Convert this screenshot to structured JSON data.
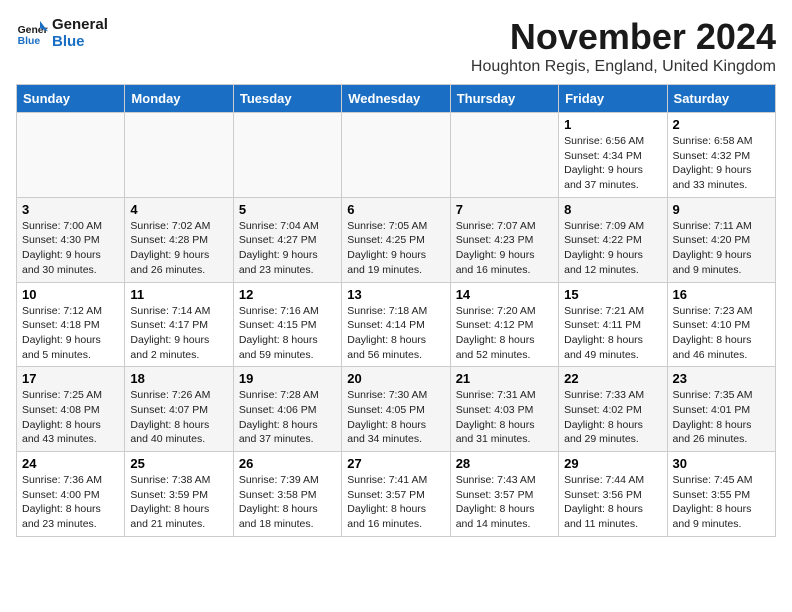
{
  "logo": {
    "line1": "General",
    "line2": "Blue"
  },
  "title": "November 2024",
  "subtitle": "Houghton Regis, England, United Kingdom",
  "days_of_week": [
    "Sunday",
    "Monday",
    "Tuesday",
    "Wednesday",
    "Thursday",
    "Friday",
    "Saturday"
  ],
  "weeks": [
    [
      {
        "day": "",
        "info": ""
      },
      {
        "day": "",
        "info": ""
      },
      {
        "day": "",
        "info": ""
      },
      {
        "day": "",
        "info": ""
      },
      {
        "day": "",
        "info": ""
      },
      {
        "day": "1",
        "info": "Sunrise: 6:56 AM\nSunset: 4:34 PM\nDaylight: 9 hours and 37 minutes."
      },
      {
        "day": "2",
        "info": "Sunrise: 6:58 AM\nSunset: 4:32 PM\nDaylight: 9 hours and 33 minutes."
      }
    ],
    [
      {
        "day": "3",
        "info": "Sunrise: 7:00 AM\nSunset: 4:30 PM\nDaylight: 9 hours and 30 minutes."
      },
      {
        "day": "4",
        "info": "Sunrise: 7:02 AM\nSunset: 4:28 PM\nDaylight: 9 hours and 26 minutes."
      },
      {
        "day": "5",
        "info": "Sunrise: 7:04 AM\nSunset: 4:27 PM\nDaylight: 9 hours and 23 minutes."
      },
      {
        "day": "6",
        "info": "Sunrise: 7:05 AM\nSunset: 4:25 PM\nDaylight: 9 hours and 19 minutes."
      },
      {
        "day": "7",
        "info": "Sunrise: 7:07 AM\nSunset: 4:23 PM\nDaylight: 9 hours and 16 minutes."
      },
      {
        "day": "8",
        "info": "Sunrise: 7:09 AM\nSunset: 4:22 PM\nDaylight: 9 hours and 12 minutes."
      },
      {
        "day": "9",
        "info": "Sunrise: 7:11 AM\nSunset: 4:20 PM\nDaylight: 9 hours and 9 minutes."
      }
    ],
    [
      {
        "day": "10",
        "info": "Sunrise: 7:12 AM\nSunset: 4:18 PM\nDaylight: 9 hours and 5 minutes."
      },
      {
        "day": "11",
        "info": "Sunrise: 7:14 AM\nSunset: 4:17 PM\nDaylight: 9 hours and 2 minutes."
      },
      {
        "day": "12",
        "info": "Sunrise: 7:16 AM\nSunset: 4:15 PM\nDaylight: 8 hours and 59 minutes."
      },
      {
        "day": "13",
        "info": "Sunrise: 7:18 AM\nSunset: 4:14 PM\nDaylight: 8 hours and 56 minutes."
      },
      {
        "day": "14",
        "info": "Sunrise: 7:20 AM\nSunset: 4:12 PM\nDaylight: 8 hours and 52 minutes."
      },
      {
        "day": "15",
        "info": "Sunrise: 7:21 AM\nSunset: 4:11 PM\nDaylight: 8 hours and 49 minutes."
      },
      {
        "day": "16",
        "info": "Sunrise: 7:23 AM\nSunset: 4:10 PM\nDaylight: 8 hours and 46 minutes."
      }
    ],
    [
      {
        "day": "17",
        "info": "Sunrise: 7:25 AM\nSunset: 4:08 PM\nDaylight: 8 hours and 43 minutes."
      },
      {
        "day": "18",
        "info": "Sunrise: 7:26 AM\nSunset: 4:07 PM\nDaylight: 8 hours and 40 minutes."
      },
      {
        "day": "19",
        "info": "Sunrise: 7:28 AM\nSunset: 4:06 PM\nDaylight: 8 hours and 37 minutes."
      },
      {
        "day": "20",
        "info": "Sunrise: 7:30 AM\nSunset: 4:05 PM\nDaylight: 8 hours and 34 minutes."
      },
      {
        "day": "21",
        "info": "Sunrise: 7:31 AM\nSunset: 4:03 PM\nDaylight: 8 hours and 31 minutes."
      },
      {
        "day": "22",
        "info": "Sunrise: 7:33 AM\nSunset: 4:02 PM\nDaylight: 8 hours and 29 minutes."
      },
      {
        "day": "23",
        "info": "Sunrise: 7:35 AM\nSunset: 4:01 PM\nDaylight: 8 hours and 26 minutes."
      }
    ],
    [
      {
        "day": "24",
        "info": "Sunrise: 7:36 AM\nSunset: 4:00 PM\nDaylight: 8 hours and 23 minutes."
      },
      {
        "day": "25",
        "info": "Sunrise: 7:38 AM\nSunset: 3:59 PM\nDaylight: 8 hours and 21 minutes."
      },
      {
        "day": "26",
        "info": "Sunrise: 7:39 AM\nSunset: 3:58 PM\nDaylight: 8 hours and 18 minutes."
      },
      {
        "day": "27",
        "info": "Sunrise: 7:41 AM\nSunset: 3:57 PM\nDaylight: 8 hours and 16 minutes."
      },
      {
        "day": "28",
        "info": "Sunrise: 7:43 AM\nSunset: 3:57 PM\nDaylight: 8 hours and 14 minutes."
      },
      {
        "day": "29",
        "info": "Sunrise: 7:44 AM\nSunset: 3:56 PM\nDaylight: 8 hours and 11 minutes."
      },
      {
        "day": "30",
        "info": "Sunrise: 7:45 AM\nSunset: 3:55 PM\nDaylight: 8 hours and 9 minutes."
      }
    ]
  ]
}
